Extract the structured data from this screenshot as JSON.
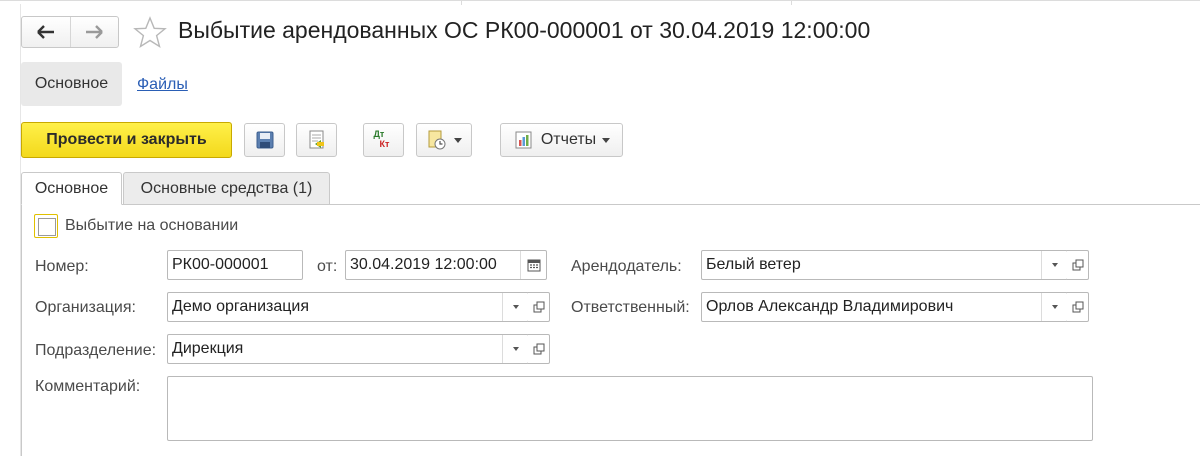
{
  "window": {
    "title": "Выбытие арендованных ОС РК00-000001 от 30.04.2019 12:00:00"
  },
  "sections": {
    "main": "Основное",
    "files": "Файлы"
  },
  "toolbar": {
    "post_close": "Провести и закрыть",
    "reports": "Отчеты",
    "dtkt_top": "Дт",
    "dtkt_bottom": "Кт"
  },
  "tabs": {
    "main": "Основное",
    "assets": "Основные средства (1)"
  },
  "form": {
    "basis_label": "Выбытие на основании",
    "basis_checked": false,
    "number_label": "Номер:",
    "number_value": "РК00-000001",
    "date_label": "от:",
    "date_value": "30.04.2019 12:00:00",
    "lessor_label": "Арендодатель:",
    "lessor_value": "Белый ветер",
    "org_label": "Организация:",
    "org_value": "Демо организация",
    "resp_label": "Ответственный:",
    "resp_value": "Орлов Александр Владимирович",
    "dept_label": "Подразделение:",
    "dept_value": "Дирекция",
    "comment_label": "Комментарий:",
    "comment_value": ""
  },
  "colors": {
    "primary_button": "#f3d91c",
    "link": "#2a5eb5"
  },
  "icons": [
    "back-arrow-icon",
    "forward-arrow-icon",
    "star-icon",
    "save-icon",
    "post-icon",
    "dt-kt-icon",
    "create-based-icon",
    "reports-icon",
    "calendar-icon",
    "open-icon"
  ]
}
